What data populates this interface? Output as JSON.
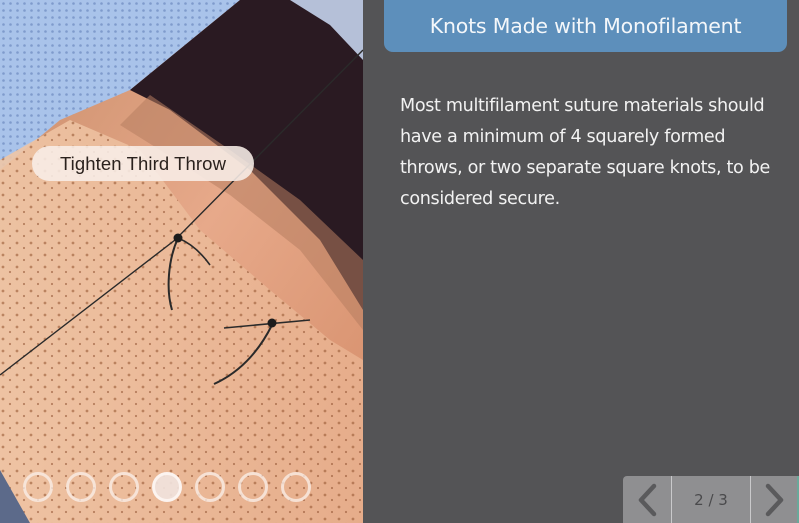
{
  "slide": {
    "title": "Knots Made with Monofilament",
    "body": "Most multifilament suture materials should have a minimum of 4 squarely formed throws, or two separate square knots, to be considered secure.",
    "callout": "Tighten Third Throw",
    "image_description": "Close-up photo of sutured skin showing a knot being tied with monofilament suture"
  },
  "carousel": {
    "total_steps": 7,
    "active_step": 4,
    "dots": [
      {
        "label": "step 1",
        "active": false
      },
      {
        "label": "step 2",
        "active": false
      },
      {
        "label": "step 3",
        "active": false
      },
      {
        "label": "step 4",
        "active": true
      },
      {
        "label": "step 5",
        "active": false
      },
      {
        "label": "step 6",
        "active": false
      },
      {
        "label": "step 7",
        "active": false
      }
    ]
  },
  "navigation": {
    "page_indicator": "2 / 3",
    "prev_icon": "chevron-left-icon",
    "next_icon": "chevron-right-icon"
  },
  "colors": {
    "background": "#545456",
    "title_banner": "#5d8fbb",
    "nav_bar": "#8f8f91"
  }
}
